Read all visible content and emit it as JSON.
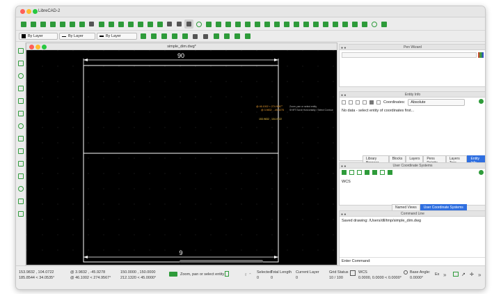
{
  "app": {
    "title": "LibreCAD-2"
  },
  "layer_bar": {
    "color": "By Layer",
    "linetype": "By Layer",
    "width": "By Layer"
  },
  "drawing": {
    "filename": "simple_dim.dwg*",
    "dim_top": "90",
    "dim_bottom": "9",
    "coord_line1": "@ 46.1002 < 274.9567°",
    "coord_line2": "@ 3.9832 , -45.9278",
    "coord_line3": "153.9832 , 104.0722",
    "hint_line1": "Zoom, pan or select entity",
    "hint_line2": "SHIFT:Scroll Horizontally / Select Contour"
  },
  "pen_wizard": {
    "title": "Pen Wizard"
  },
  "entity_info": {
    "title": "Entity Info",
    "coordinates_label": "Coordinates:",
    "coordinates_mode": "Absolute",
    "message": "No data - select entity of coordinates first..."
  },
  "dock_tabs": [
    "Library Browser",
    "Blocks",
    "Layers",
    "Pens Palette",
    "Layers Tree",
    "Entity Info"
  ],
  "ucs": {
    "title": "User Coordinate Systems",
    "item": "WCS"
  },
  "ucs_tabs": [
    "Named Views",
    "User Coordinate Systems"
  ],
  "command_line": {
    "title": "Command Line",
    "output": "Saved drawing: /Users/dll/tmp/simple_dim.dwg",
    "prompt": "Enter Command:"
  },
  "status": {
    "abs_coord": "153.9832 , 104.0722",
    "abs_polar": "185.8544 < 34.0535°",
    "rel_coord": "@ 3.9832 , -45.9278",
    "rel_polar": "@ 46.1002 < 274.9567°",
    "ref_coord": "150.0000 , 150.0000",
    "ref_polar": "212.1320 < 45.0000°",
    "hint": "Zoom, pan or select entity",
    "selected_label": "Selected",
    "selected_value": "0",
    "total_length_label": "Total Length",
    "total_length_value": "0",
    "current_layer_label": "Current Layer",
    "current_layer_value": "0",
    "grid_status_label": "Grid Status",
    "grid_status_value": "10 / 100",
    "wcs_label": "WCS",
    "wcs_value": "0.0000, 0.0000 < 0.0000°",
    "base_angle_label": "Base Angle:",
    "base_angle_value": "0.0000°",
    "ex_label": "Ex"
  },
  "colors": {
    "accent": "#2f6fe0",
    "icon_green": "#2e9b3a",
    "canvas": "#000000",
    "coord_orange": "#f0a030",
    "coord_yellow": "#ffd24a"
  }
}
